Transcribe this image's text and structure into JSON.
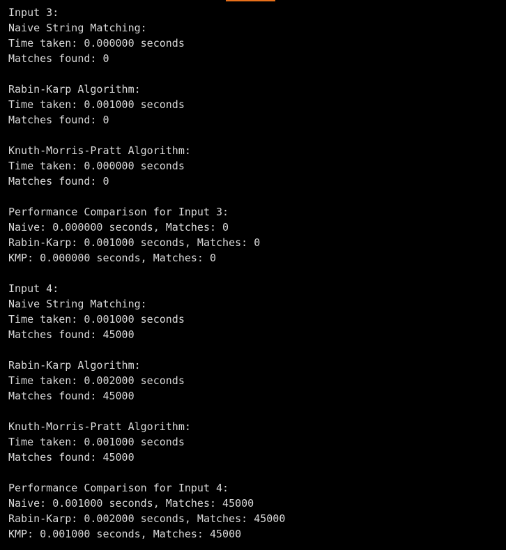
{
  "theme": {
    "background": "#000000",
    "foreground": "#d9d9d9",
    "scroll_indicator": "#e8701a"
  },
  "terminal": {
    "lines": [
      "Input 3:",
      "Naive String Matching:",
      "Time taken: 0.000000 seconds",
      "Matches found: 0",
      "",
      "Rabin-Karp Algorithm:",
      "Time taken: 0.001000 seconds",
      "Matches found: 0",
      "",
      "Knuth-Morris-Pratt Algorithm:",
      "Time taken: 0.000000 seconds",
      "Matches found: 0",
      "",
      "Performance Comparison for Input 3:",
      "Naive: 0.000000 seconds, Matches: 0",
      "Rabin-Karp: 0.001000 seconds, Matches: 0",
      "KMP: 0.000000 seconds, Matches: 0",
      "",
      "Input 4:",
      "Naive String Matching:",
      "Time taken: 0.001000 seconds",
      "Matches found: 45000",
      "",
      "Rabin-Karp Algorithm:",
      "Time taken: 0.002000 seconds",
      "Matches found: 45000",
      "",
      "Knuth-Morris-Pratt Algorithm:",
      "Time taken: 0.001000 seconds",
      "Matches found: 45000",
      "",
      "Performance Comparison for Input 4:",
      "Naive: 0.001000 seconds, Matches: 45000",
      "Rabin-Karp: 0.002000 seconds, Matches: 45000",
      "KMP: 0.001000 seconds, Matches: 45000"
    ]
  }
}
